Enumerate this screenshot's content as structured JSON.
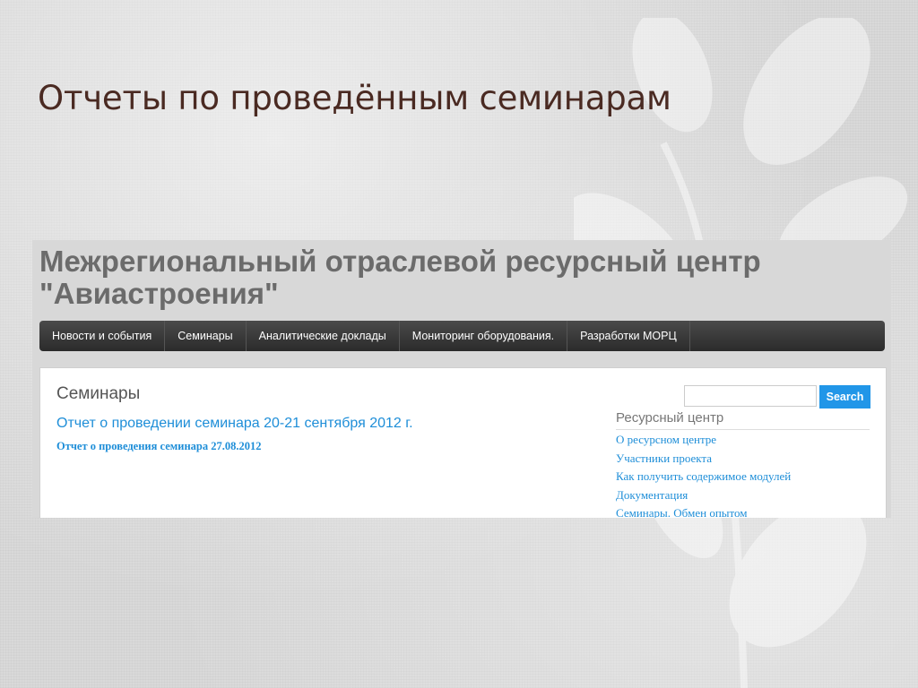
{
  "slide": {
    "title": "Отчеты по проведённым семинарам"
  },
  "site": {
    "title": "Межрегиональный отраслевой ресурсный центр \"Авиастроения\""
  },
  "nav": {
    "items": [
      {
        "label": "Новости и события"
      },
      {
        "label": "Семинары"
      },
      {
        "label": "Аналитические доклады"
      },
      {
        "label": "Мониторинг оборудования."
      },
      {
        "label": "Разработки МОРЦ"
      }
    ]
  },
  "main": {
    "heading": "Семинары",
    "reports": [
      {
        "label": "Отчет о проведении семинара 20-21 сентября 2012 г."
      },
      {
        "label": "Отчет о проведения семинара 27.08.2012"
      }
    ]
  },
  "search": {
    "value": "",
    "button_label": "Search"
  },
  "sidebar": {
    "heading": "Ресурсный центр",
    "links": [
      {
        "label": "О ресурсном центре"
      },
      {
        "label": "Участники проекта"
      },
      {
        "label": "Как получить содержимое модулей"
      },
      {
        "label": "Документация"
      },
      {
        "label": "Семинары. Обмен опытом"
      }
    ]
  },
  "colors": {
    "slide_title": "#4a2a22",
    "nav_bg": "#2b2b2b",
    "link": "#1e8ed8",
    "search_button": "#2196e8"
  }
}
